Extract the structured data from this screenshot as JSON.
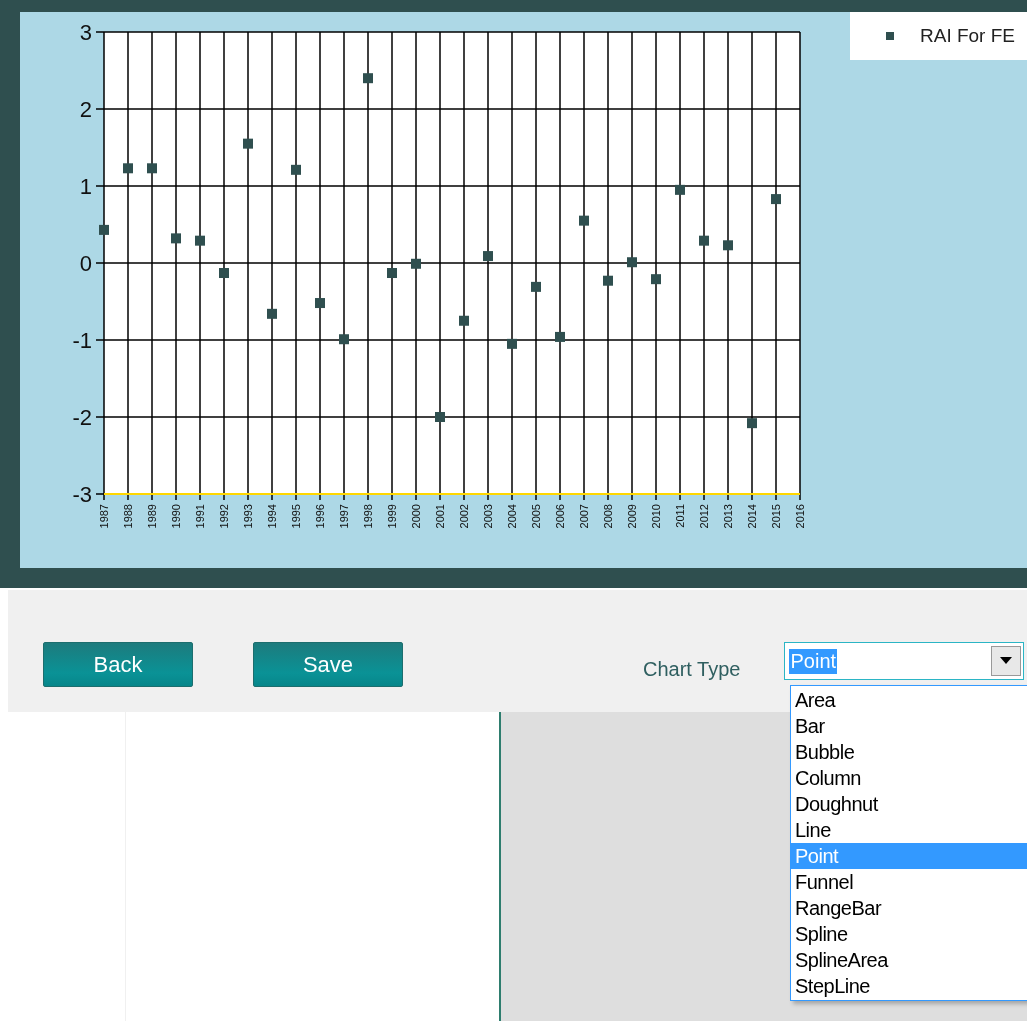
{
  "chart": {
    "chart_data": {
      "type": "scatter",
      "grid": true,
      "categories": [
        "1987",
        "1988",
        "1989",
        "1990",
        "1991",
        "1992",
        "1993",
        "1994",
        "1995",
        "1996",
        "1997",
        "1998",
        "1999",
        "2000",
        "2001",
        "2002",
        "2003",
        "2004",
        "2005",
        "2006",
        "2007",
        "2008",
        "2009",
        "2010",
        "2011",
        "2012",
        "2013",
        "2014",
        "2015",
        "2016"
      ],
      "series": [
        {
          "name": "RAI For FE",
          "color": "#2f4f4f",
          "values": [
            0.43,
            1.23,
            1.23,
            0.32,
            0.29,
            -0.13,
            1.55,
            -0.66,
            1.21,
            -0.52,
            -0.99,
            2.4,
            -0.13,
            -0.01,
            -2.0,
            -0.75,
            0.09,
            -1.05,
            -0.31,
            -0.96,
            0.55,
            -0.23,
            0.01,
            -0.21,
            0.95,
            0.29,
            0.23,
            -2.08,
            0.83,
            null
          ]
        }
      ],
      "ylim": [
        -3,
        3
      ],
      "yticks": [
        -3,
        -2,
        -1,
        0,
        1,
        2,
        3
      ]
    }
  },
  "toolbar": {
    "buttons": [
      {
        "label": "Back"
      },
      {
        "label": "Save"
      }
    ],
    "chart_type": {
      "label": "Chart Type",
      "value": "Point",
      "options": [
        {
          "label": "Area",
          "selected": false
        },
        {
          "label": "Bar",
          "selected": false
        },
        {
          "label": "Bubble",
          "selected": false
        },
        {
          "label": "Column",
          "selected": false
        },
        {
          "label": "Doughnut",
          "selected": false
        },
        {
          "label": "Line",
          "selected": false
        },
        {
          "label": "Point",
          "selected": true
        },
        {
          "label": "Funnel",
          "selected": false
        },
        {
          "label": "RangeBar",
          "selected": false
        },
        {
          "label": "Spline",
          "selected": false
        },
        {
          "label": "SplineArea",
          "selected": false
        },
        {
          "label": "StepLine",
          "selected": false
        }
      ]
    }
  }
}
